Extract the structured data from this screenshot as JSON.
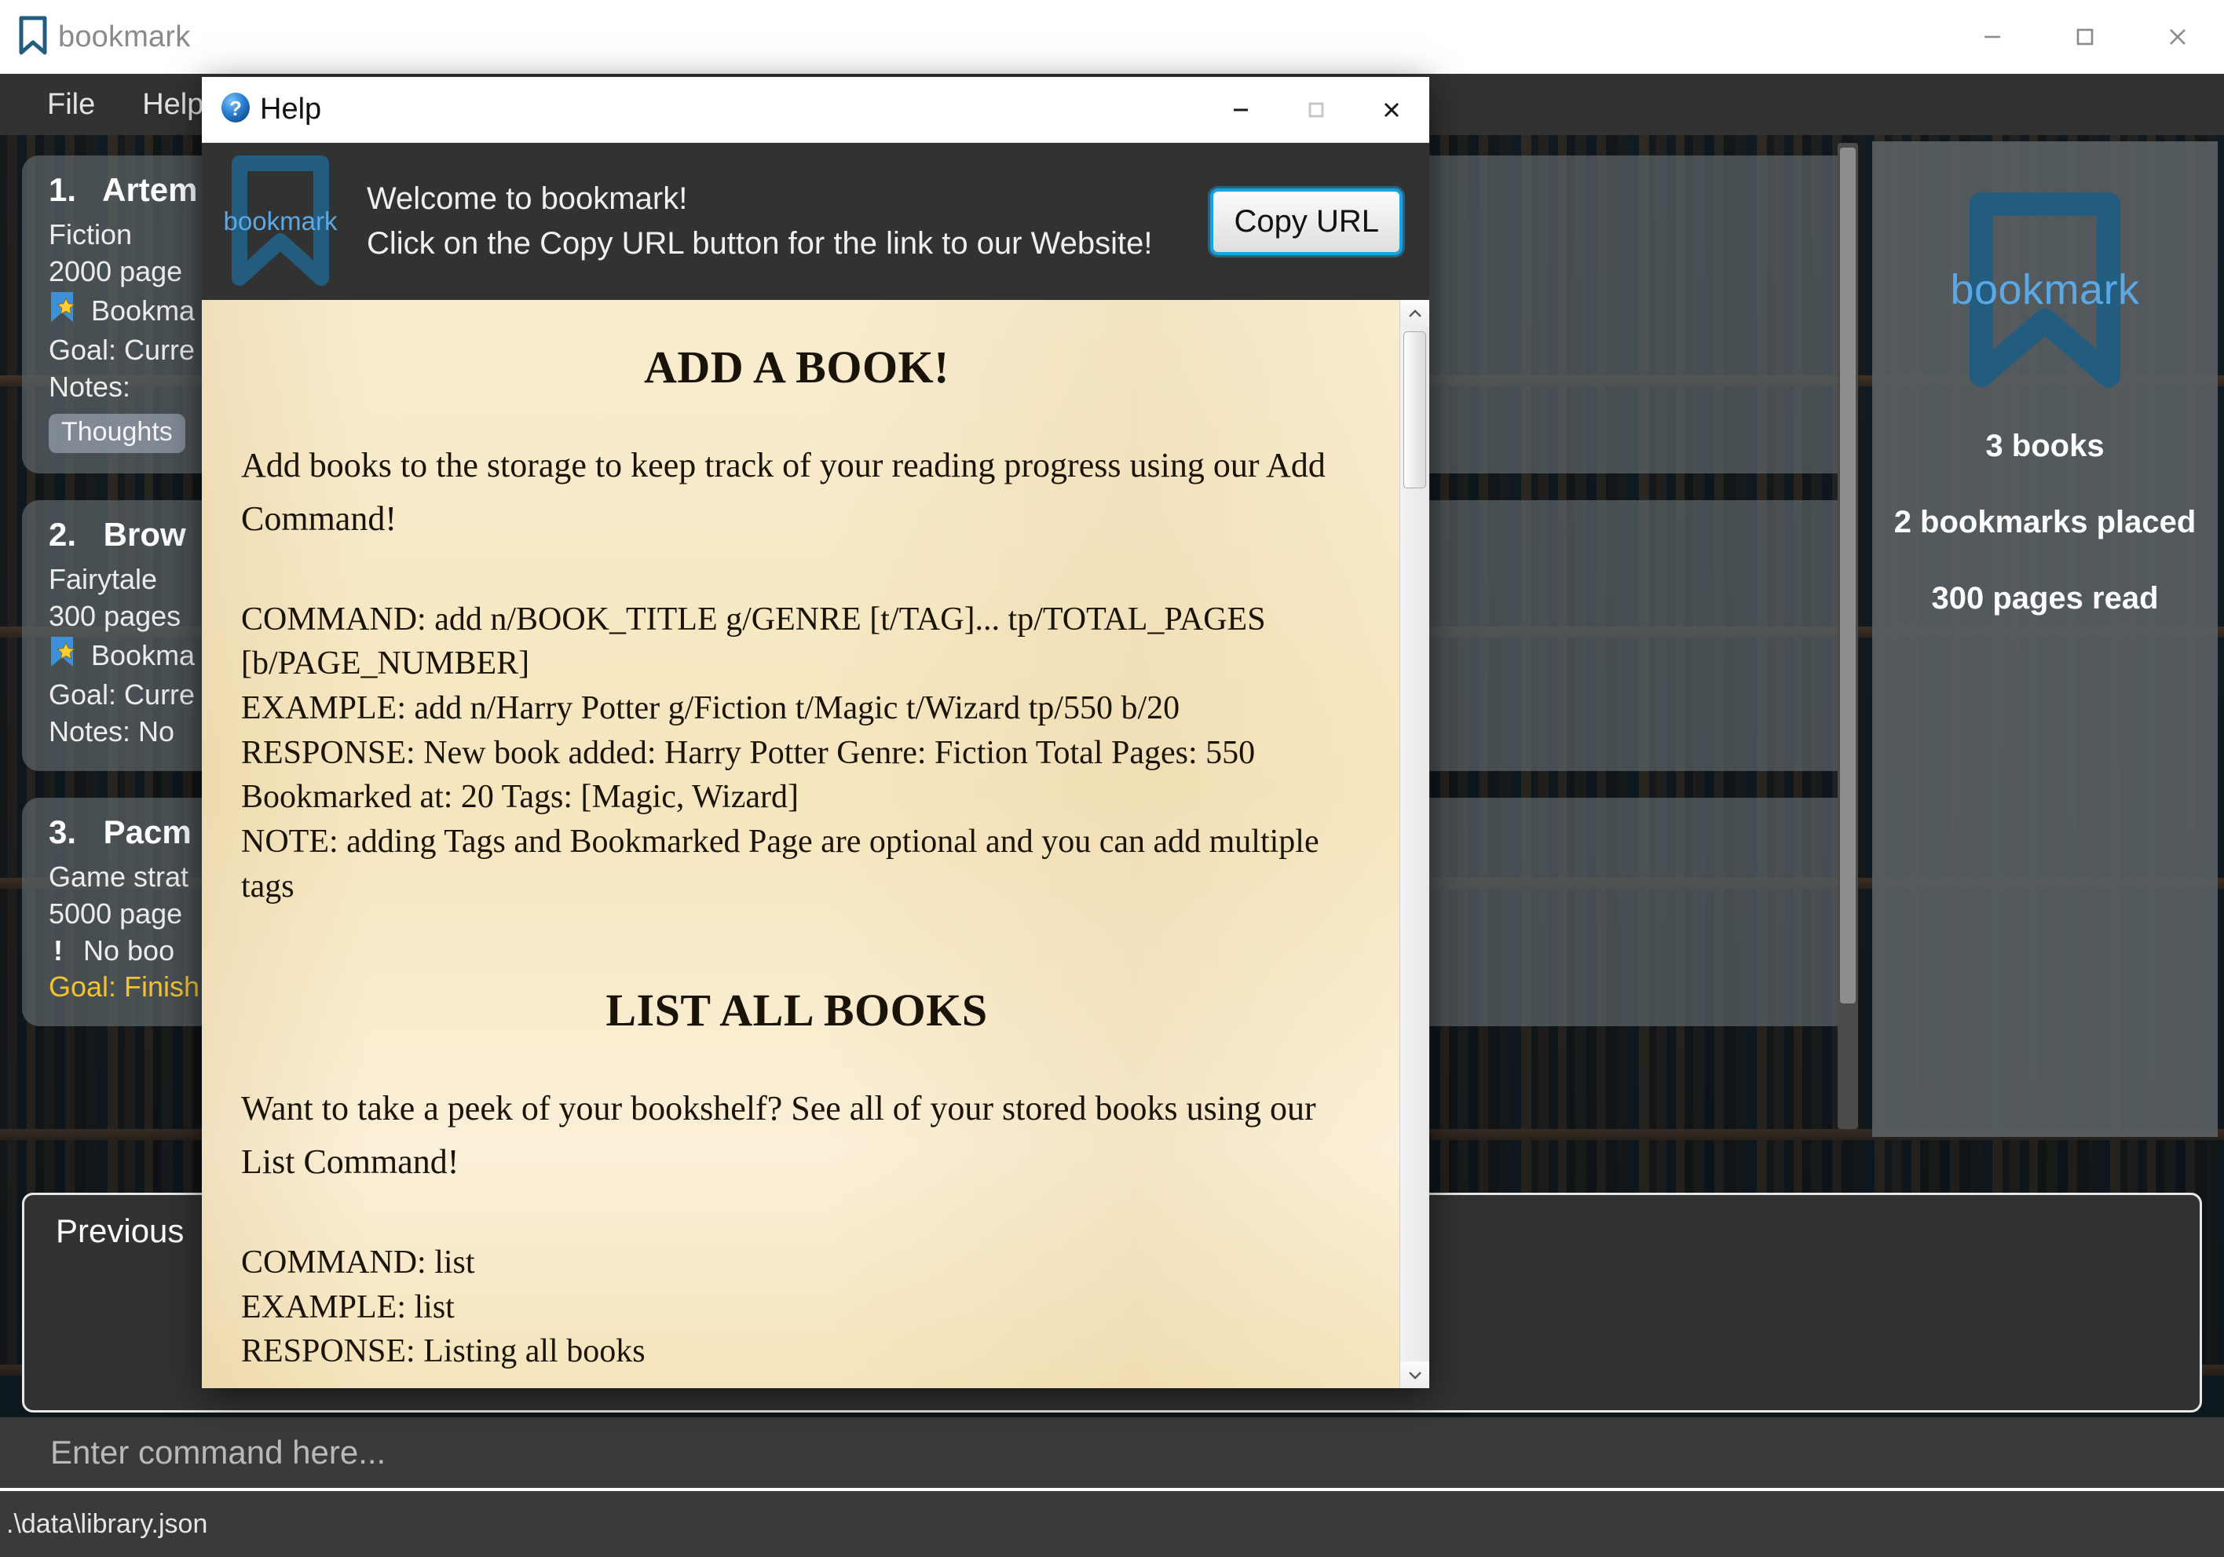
{
  "app": {
    "title": "bookmark",
    "logo_icon": "bookmark-icon",
    "window_controls": {
      "minimize": "minimize-icon",
      "maximize": "maximize-icon",
      "close": "close-icon"
    },
    "menu": [
      {
        "label": "File"
      },
      {
        "label": "Help"
      }
    ],
    "command_input": {
      "placeholder": "Enter command here...",
      "value": ""
    },
    "previous_panel": {
      "label": "Previous"
    },
    "statusbar": {
      "text": ".\\data\\library.json"
    }
  },
  "books": [
    {
      "index": "1.",
      "title": "Artem",
      "genre": "Fiction",
      "pages": "2000 page",
      "bookmark_icon": "bookmark-star-icon",
      "bookmark_line": "Bookma",
      "goal": "Goal: Curre",
      "notes": "Notes:",
      "tags": [
        "Thoughts"
      ]
    },
    {
      "index": "2.",
      "title": "Brow",
      "genre": "Fairytale",
      "pages": "300 pages",
      "bookmark_icon": "bookmark-star-icon",
      "bookmark_line": "Bookma",
      "goal": "Goal: Curre",
      "notes": "Notes: No",
      "tags": []
    },
    {
      "index": "3.",
      "title": "Pacm",
      "genre": "Game strat",
      "pages": "5000 page",
      "bookmark_icon": "warning-icon",
      "bookmark_line": "No boo",
      "goal": "Goal: Finish",
      "notes": "",
      "tags": []
    }
  ],
  "sidebar": {
    "logo_icon": "bookmark-icon",
    "logo_word": "bookmark",
    "stats": [
      "3 books",
      "2 bookmarks placed",
      "300 pages read"
    ]
  },
  "help_dialog": {
    "title": "Help",
    "title_icon": "question-mark-icon",
    "window_controls": {
      "minimize": "minimize-icon",
      "maximize": "maximize-icon",
      "close": "close-icon"
    },
    "banner": {
      "logo_icon": "bookmark-icon",
      "logo_word": "bookmark",
      "line1": "Welcome to bookmark!",
      "line2": "Click on the Copy URL button for the link to our Website!",
      "copy_button": "Copy URL"
    },
    "sections": [
      {
        "heading": "ADD A BOOK!",
        "paragraph": "Add books to the storage to keep track of your reading progress using our Add Command!",
        "rows": [
          "COMMAND: add n/BOOK_TITLE g/GENRE [t/TAG]... tp/TOTAL_PAGES [b/PAGE_NUMBER]",
          "EXAMPLE: add n/Harry Potter g/Fiction t/Magic t/Wizard tp/550 b/20",
          "RESPONSE: New book added: Harry Potter Genre: Fiction Total Pages: 550 Bookmarked at: 20 Tags: [Magic, Wizard]",
          "NOTE: adding Tags and Bookmarked Page are optional and you can add multiple tags"
        ]
      },
      {
        "heading": "LIST ALL BOOKS",
        "paragraph": "Want to take a peek of your bookshelf? See all of your stored books using our List Command!",
        "rows": [
          "COMMAND: list",
          "EXAMPLE: list",
          "RESPONSE: Listing all books"
        ]
      }
    ]
  },
  "colors": {
    "accent_blue": "#1ba1e2",
    "logo_blue": "#225c7e",
    "logo_word_blue": "#5aa9e6",
    "panel_dark": "#323232",
    "parchment": "#f6e6be",
    "goal_gold": "#f2c230"
  }
}
